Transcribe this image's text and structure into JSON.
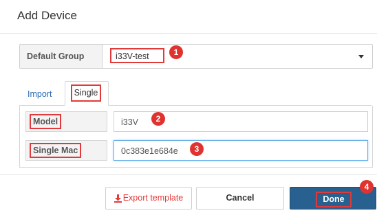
{
  "dialog": {
    "title": "Add Device"
  },
  "group": {
    "label": "Default Group",
    "value": "i33V-test",
    "badge": "1"
  },
  "tabs": [
    {
      "label": "Import"
    },
    {
      "label": "Single"
    }
  ],
  "form": {
    "model": {
      "label": "Model",
      "value": "i33V",
      "badge": "2"
    },
    "single_mac": {
      "label": "Single Mac",
      "value": "0c383e1e684e",
      "badge": "3"
    }
  },
  "footer": {
    "export_label": "Export template",
    "export_icon": "download-icon",
    "cancel_label": "Cancel",
    "done_label": "Done",
    "done_badge": "4"
  },
  "colors": {
    "primary": "#286090",
    "annotation_red": "#e03a3a",
    "link": "#2b6db3",
    "export_text": "#e33b3b"
  }
}
